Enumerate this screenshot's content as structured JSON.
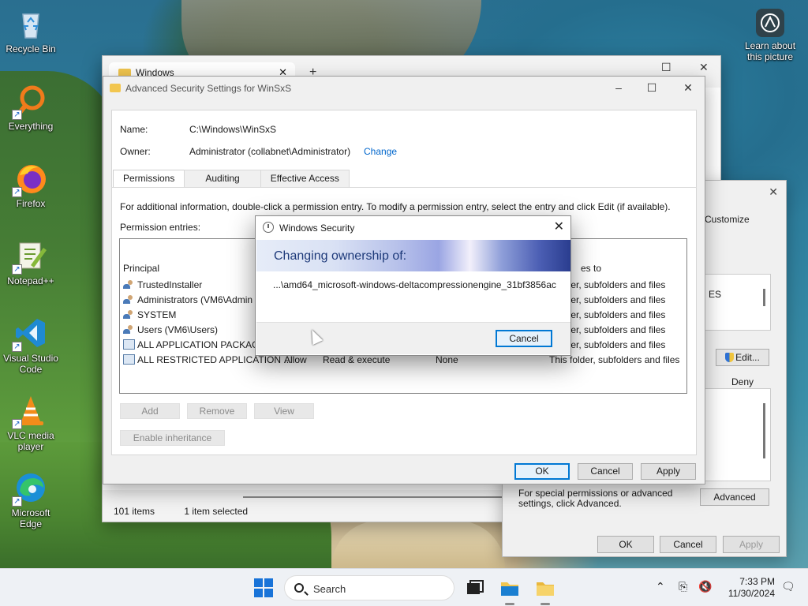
{
  "desktop": {
    "icons": [
      {
        "label": "Recycle Bin"
      },
      {
        "label": "Everything"
      },
      {
        "label": "Firefox"
      },
      {
        "label": "Notepad++"
      },
      {
        "label": "Visual Studio Code"
      },
      {
        "label": "VLC media player"
      },
      {
        "label": "Microsoft Edge"
      }
    ],
    "learn_label": "Learn about this picture"
  },
  "explorer": {
    "tab_title": "Windows",
    "status_count": "101 items",
    "status_selected": "1 item selected"
  },
  "properties": {
    "customize": "Customize",
    "list_item": "ES",
    "edit_label": "Edit...",
    "deny_label": "Deny",
    "special_text": "For special permissions or advanced settings, click Advanced.",
    "advanced_label": "Advanced",
    "ok_label": "OK",
    "cancel_label": "Cancel",
    "apply_label": "Apply"
  },
  "advanced_security": {
    "title": "Advanced Security Settings for WinSxS",
    "name_label": "Name:",
    "name_value": "C:\\Windows\\WinSxS",
    "owner_label": "Owner:",
    "owner_value": "Administrator (collabnet\\Administrator)",
    "change_link": "Change",
    "tabs": [
      "Permissions",
      "Auditing",
      "Effective Access"
    ],
    "info_text": "For additional information, double-click a permission entry. To modify a permission entry, select the entry and click Edit (if available).",
    "entries_label": "Permission entries:",
    "col_principal": "Principal",
    "col_applies": "es to",
    "rows": [
      {
        "principal": "TrustedInstaller",
        "type": "",
        "access": "",
        "inherited": "",
        "applies": "folder, subfolders and files"
      },
      {
        "principal": "Administrators (VM6\\Admin",
        "type": "",
        "access": "",
        "inherited": "",
        "applies": "folder, subfolders and files"
      },
      {
        "principal": "SYSTEM",
        "type": "",
        "access": "",
        "inherited": "",
        "applies": "folder, subfolders and files"
      },
      {
        "principal": "Users (VM6\\Users)",
        "type": "",
        "access": "",
        "inherited": "",
        "applies": "folder, subfolders and files"
      },
      {
        "principal": "ALL APPLICATION PACKAGE",
        "type": "",
        "access": "",
        "inherited": "",
        "applies": "folder, subfolders and files"
      },
      {
        "principal": "ALL RESTRICTED APPLICATION ...",
        "type": "Allow",
        "access": "Read & execute",
        "inherited": "None",
        "applies": "This folder, subfolders and files"
      }
    ],
    "add_label": "Add",
    "remove_label": "Remove",
    "view_label": "View",
    "enable_inheritance_label": "Enable inheritance",
    "ok_label": "OK",
    "cancel_label": "Cancel",
    "apply_label": "Apply"
  },
  "security_dialog": {
    "title": "Windows Security",
    "banner": "Changing ownership of:",
    "path": "...\\amd64_microsoft-windows-deltacompressionengine_31bf3856ac",
    "cancel_label": "Cancel"
  },
  "taskbar": {
    "search_placeholder": "Search",
    "time": "7:33 PM",
    "date": "11/30/2024"
  },
  "colors": {
    "accent": "#0078d4",
    "link": "#0066cc",
    "start": "#1873d8",
    "folder": "#f2c64f"
  }
}
